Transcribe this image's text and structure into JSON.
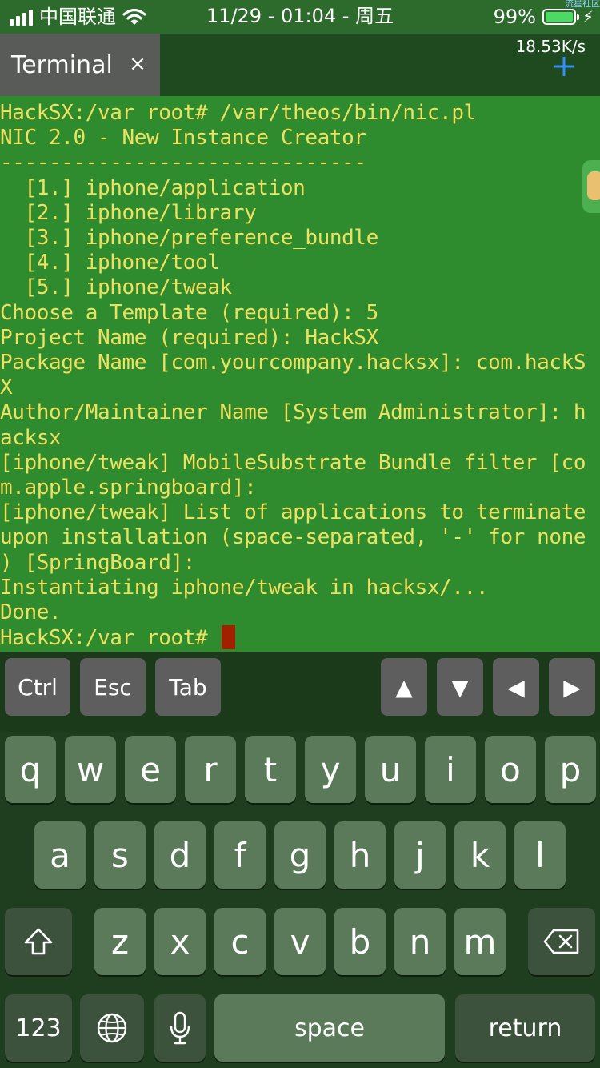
{
  "status_bar": {
    "carrier": "中国联通",
    "time": "11/29 - 01:04 - 周五",
    "battery_percent": "99%",
    "battery_level": 0.99,
    "corner_tag": "流星社区"
  },
  "tab_bar": {
    "tab_label": "Terminal",
    "close_glyph": "×",
    "net_speed": "18.53K/s",
    "add_icon": "plus-icon"
  },
  "terminal": {
    "lines": [
      "HackSX:/var root# /var/theos/bin/nic.pl",
      "NIC 2.0 - New Instance Creator",
      "------------------------------",
      "  [1.] iphone/application",
      "  [2.] iphone/library",
      "  [3.] iphone/preference_bundle",
      "  [4.] iphone/tool",
      "  [5.] iphone/tweak",
      "Choose a Template (required): 5",
      "Project Name (required): HackSX",
      "Package Name [com.yourcompany.hacksx]: com.hackS",
      "X",
      "Author/Maintainer Name [System Administrator]: h",
      "acksx",
      "[iphone/tweak] MobileSubstrate Bundle filter [co",
      "m.apple.springboard]:",
      "[iphone/tweak] List of applications to terminate",
      "upon installation (space-separated, '-' for none",
      ") [SpringBoard]:",
      "Instantiating iphone/tweak in hacksx/...",
      "Done.",
      "HackSX:/var root# "
    ]
  },
  "extra_keys": {
    "ctrl": "Ctrl",
    "esc": "Esc",
    "tab": "Tab",
    "up": "▲",
    "down": "▼",
    "left": "◀",
    "right": "▶"
  },
  "keyboard": {
    "row1": [
      "q",
      "w",
      "e",
      "r",
      "t",
      "y",
      "u",
      "i",
      "o",
      "p"
    ],
    "row2": [
      "a",
      "s",
      "d",
      "f",
      "g",
      "h",
      "j",
      "k",
      "l"
    ],
    "row3": [
      "z",
      "x",
      "c",
      "v",
      "b",
      "n",
      "m"
    ],
    "shift_icon": "shift-icon",
    "backspace_icon": "backspace-icon",
    "numbers": "123",
    "globe_icon": "globe-icon",
    "mic_icon": "microphone-icon",
    "space": "space",
    "return": "return"
  },
  "colors": {
    "terminal_bg": "#2e8b2e",
    "terminal_text": "#f0e060",
    "cursor": "#a02000",
    "battery_fill": "#4cd964",
    "accent": "#2f8fff"
  }
}
